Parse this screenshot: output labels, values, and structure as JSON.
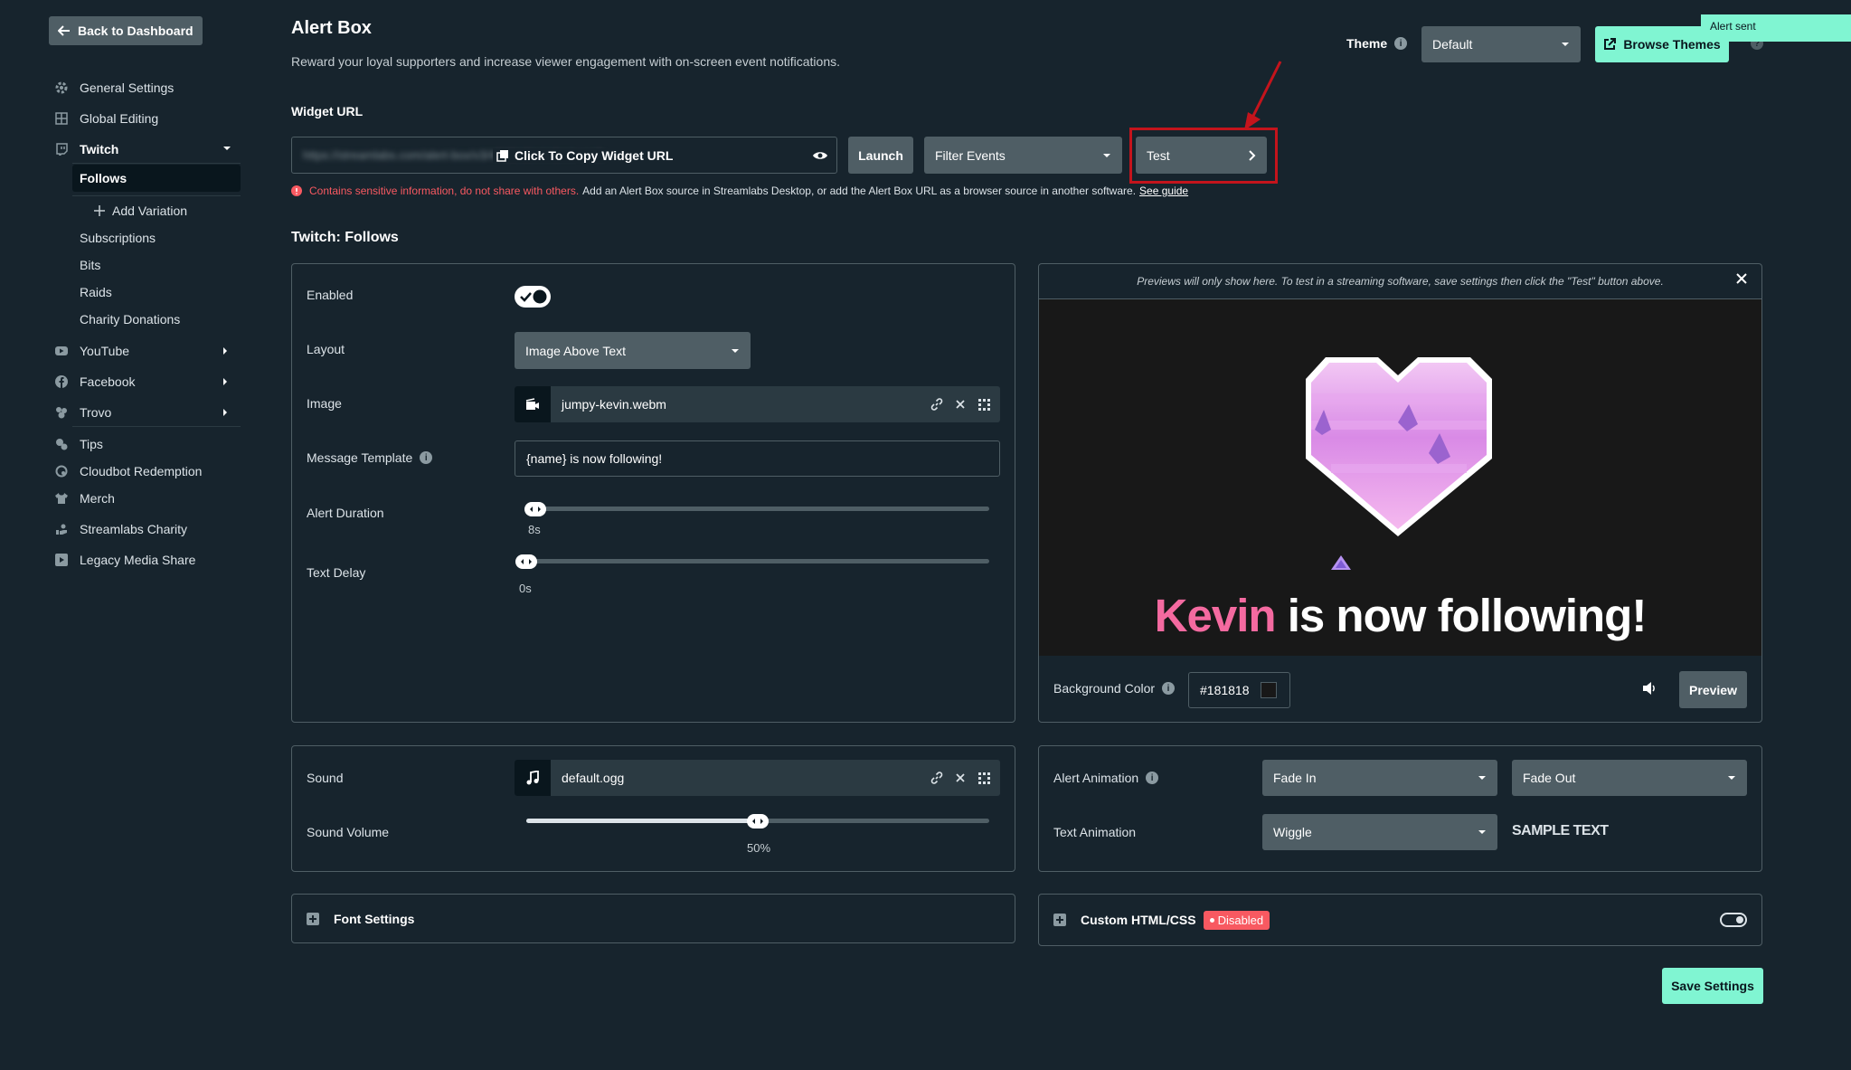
{
  "sidebar": {
    "back_label": "Back to Dashboard",
    "items": [
      {
        "label": "General Settings",
        "icon": "gear-icon"
      },
      {
        "label": "Global Editing",
        "icon": "grid-icon"
      },
      {
        "label": "Twitch",
        "icon": "twitch-icon"
      },
      {
        "label": "YouTube",
        "icon": "youtube-icon"
      },
      {
        "label": "Facebook",
        "icon": "facebook-icon"
      },
      {
        "label": "Trovo",
        "icon": "trovo-icon"
      },
      {
        "label": "Tips",
        "icon": "tips-icon"
      },
      {
        "label": "Cloudbot Redemption",
        "icon": "cloudbot-icon"
      },
      {
        "label": "Merch",
        "icon": "merch-icon"
      },
      {
        "label": "Streamlabs Charity",
        "icon": "charity-icon"
      },
      {
        "label": "Legacy Media Share",
        "icon": "media-share-icon"
      }
    ],
    "twitch_sub": [
      "Follows",
      "Add Variation",
      "Subscriptions",
      "Bits",
      "Raids",
      "Charity Donations"
    ]
  },
  "header": {
    "title": "Alert Box",
    "subtitle": "Reward your loyal supporters and increase viewer engagement with on-screen event notifications.",
    "theme_label": "Theme",
    "theme_value": "Default",
    "browse_themes": "Browse Themes",
    "toast": "Alert sent"
  },
  "widget": {
    "label": "Widget URL",
    "url_blurred": "https://streamlabs.com/alert-box/v3/4F3E6E0C9B6C4A0B",
    "copy_label": "Click To Copy Widget URL",
    "launch": "Launch",
    "filter": "Filter Events",
    "test": "Test",
    "warn_red": "Contains sensitive information, do not share with others.",
    "warn_rest": "Add an Alert Box source in Streamlabs Desktop, or add the Alert Box URL as a browser source in another software.",
    "warn_link": "See guide"
  },
  "section_title": "Twitch: Follows",
  "settings": {
    "enabled_label": "Enabled",
    "enabled": true,
    "layout_label": "Layout",
    "layout_value": "Image Above Text",
    "image_label": "Image",
    "image_file": "jumpy-kevin.webm",
    "message_label": "Message Template",
    "message_value": "{name} is now following!",
    "duration_label": "Alert Duration",
    "duration_value": "8s",
    "duration_level": 0.0,
    "text_delay_label": "Text Delay",
    "text_delay_value": "0s",
    "text_delay_level": 0.0
  },
  "preview": {
    "note": "Previews will only show here. To test in a streaming software, save settings then click the \"Test\" button above.",
    "name": "Kevin",
    "message": " is now following!",
    "bg_label": "Background Color",
    "bg_value": "#181818",
    "preview_btn": "Preview"
  },
  "sound": {
    "sound_label": "Sound",
    "sound_file": "default.ogg",
    "volume_label": "Sound Volume",
    "volume_value": "50%",
    "volume_level": 0.5
  },
  "animation": {
    "alert_label": "Alert Animation",
    "in_value": "Fade In",
    "out_value": "Fade Out",
    "text_label": "Text Animation",
    "text_value": "Wiggle",
    "sample": "SAMPLE TEXT"
  },
  "font_settings": "Font Settings",
  "custom": {
    "label": "Custom HTML/CSS",
    "badge": "Disabled"
  },
  "save": "Save Settings",
  "colors": {
    "bg": "#17242d",
    "accent": "#80f5d2",
    "danger": "#f85961",
    "highlight": "#c4141c"
  }
}
